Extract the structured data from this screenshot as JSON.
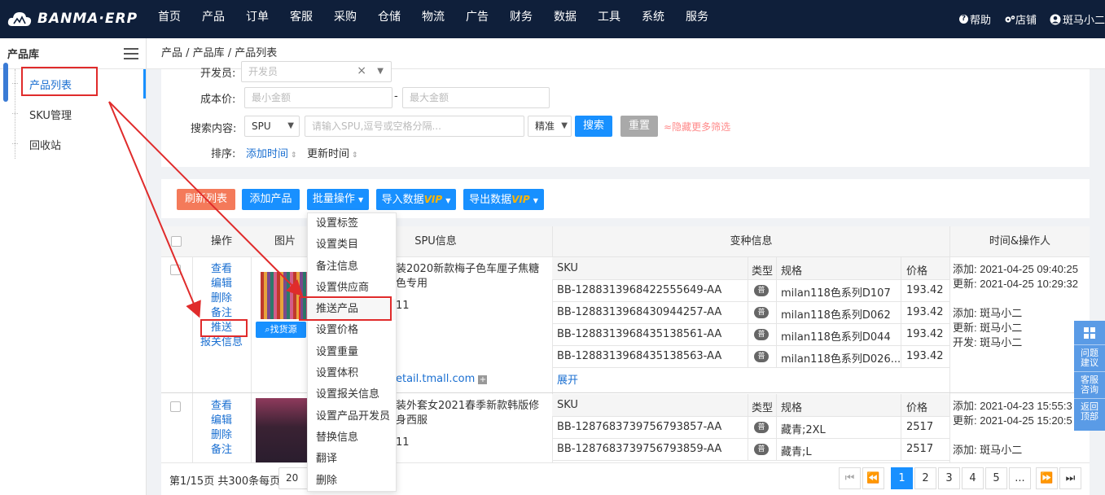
{
  "brand": {
    "name": "BANMA·ERP"
  },
  "nav": [
    "首页",
    "产品",
    "订单",
    "客服",
    "采购",
    "仓储",
    "物流",
    "广告",
    "财务",
    "数据",
    "工具",
    "系统",
    "服务"
  ],
  "top_right": {
    "help": "帮助",
    "store": "店铺",
    "user": "斑马小二"
  },
  "sidebar": {
    "title": "产品库",
    "items": [
      {
        "label": "产品列表"
      },
      {
        "label": "SKU管理"
      },
      {
        "label": "回收站"
      }
    ]
  },
  "breadcrumb": "产品 / 产品库 / 产品列表",
  "filters": {
    "developer_label": "开发员:",
    "developer_placeholder": "开发员",
    "cost_label": "成本价:",
    "min_placeholder": "最小金额",
    "max_placeholder": "最大金额",
    "range_sep": "-",
    "search_label": "搜索内容:",
    "search_field": "SPU",
    "search_placeholder": "请输入SPU,逗号或空格分隔...",
    "match_mode": "精准",
    "search_btn": "搜索",
    "reset_btn": "重置",
    "more_filters": "隐藏更多筛选",
    "sort_label": "排序:",
    "sort_added": "添加时间",
    "sort_updated": "更新时间"
  },
  "toolbar": {
    "refresh": "刷新列表",
    "add": "添加产品",
    "batch": "批量操作",
    "import": "导入数据",
    "export": "导出数据",
    "vip": "VIP"
  },
  "batch_menu": [
    "设置标签",
    "设置类目",
    "备注信息",
    "设置供应商",
    "推送产品",
    "设置价格",
    "设置重量",
    "设置体积",
    "设置报关信息",
    "设置产品开发员",
    "替换信息",
    "翻译",
    "删除"
  ],
  "table": {
    "headers": {
      "ops": "操作",
      "image": "图片",
      "spu": "SPU信息",
      "variants": "变种信息",
      "time": "时间&操作人"
    },
    "variant_headers": {
      "sku": "SKU",
      "type": "类型",
      "spec": "规格",
      "price": "价格"
    },
    "type_badge": "普",
    "expand": "展开",
    "find_source": "找货源",
    "rows": [
      {
        "ops": [
          "查看",
          "编辑",
          "删除",
          "备注",
          "推送",
          "报关信息"
        ],
        "spu_title": "装2020新款梅子色车厘子焦糖色专用",
        "spu_count": "11",
        "spu_link": "etail.tmall.com",
        "variants": [
          {
            "sku": "BB-128831396842255564​9-AA",
            "spec": "milan118色系列D107",
            "price": "193.42"
          },
          {
            "sku": "BB-1288313968430944257-AA",
            "spec": "milan118色系列D062",
            "price": "193.42"
          },
          {
            "sku": "BB-1288313968435138561-AA",
            "spec": "milan118色系列D044",
            "price": "193.42"
          },
          {
            "sku": "BB-1288313968435138563-AA",
            "spec": "milan118色系列D026...",
            "price": "193.42"
          }
        ],
        "time_lines": [
          "添加: 2021-04-25 09:40:25",
          "更新: 2021-04-25 10:29:32",
          "",
          "添加: 斑马小二",
          "更新: 斑马小二",
          "开发: 斑马小二"
        ]
      },
      {
        "ops": [
          "查看",
          "编辑",
          "删除",
          "备注"
        ],
        "spu_title": "装外套女2021春季新款韩版修身西服",
        "spu_count": "11",
        "variants": [
          {
            "sku": "BB-1287683739756793857-AA",
            "spec": "藏青;2XL",
            "price": "2517"
          },
          {
            "sku": "BB-1287683739756793859-AA",
            "spec": "藏青;L",
            "price": "2517"
          }
        ],
        "time_lines": [
          "添加: 2021-04-23 15:55:3",
          "更新: 2021-04-25 15:20:5",
          "",
          "添加: 斑马小二"
        ]
      }
    ]
  },
  "pager": {
    "summary": "第1/15页 共300条每页",
    "page_size": "20",
    "pages": [
      "1",
      "2",
      "3",
      "4",
      "5",
      "..."
    ]
  },
  "float_bar": [
    "问题建议",
    "客服咨询",
    "返回顶部"
  ]
}
